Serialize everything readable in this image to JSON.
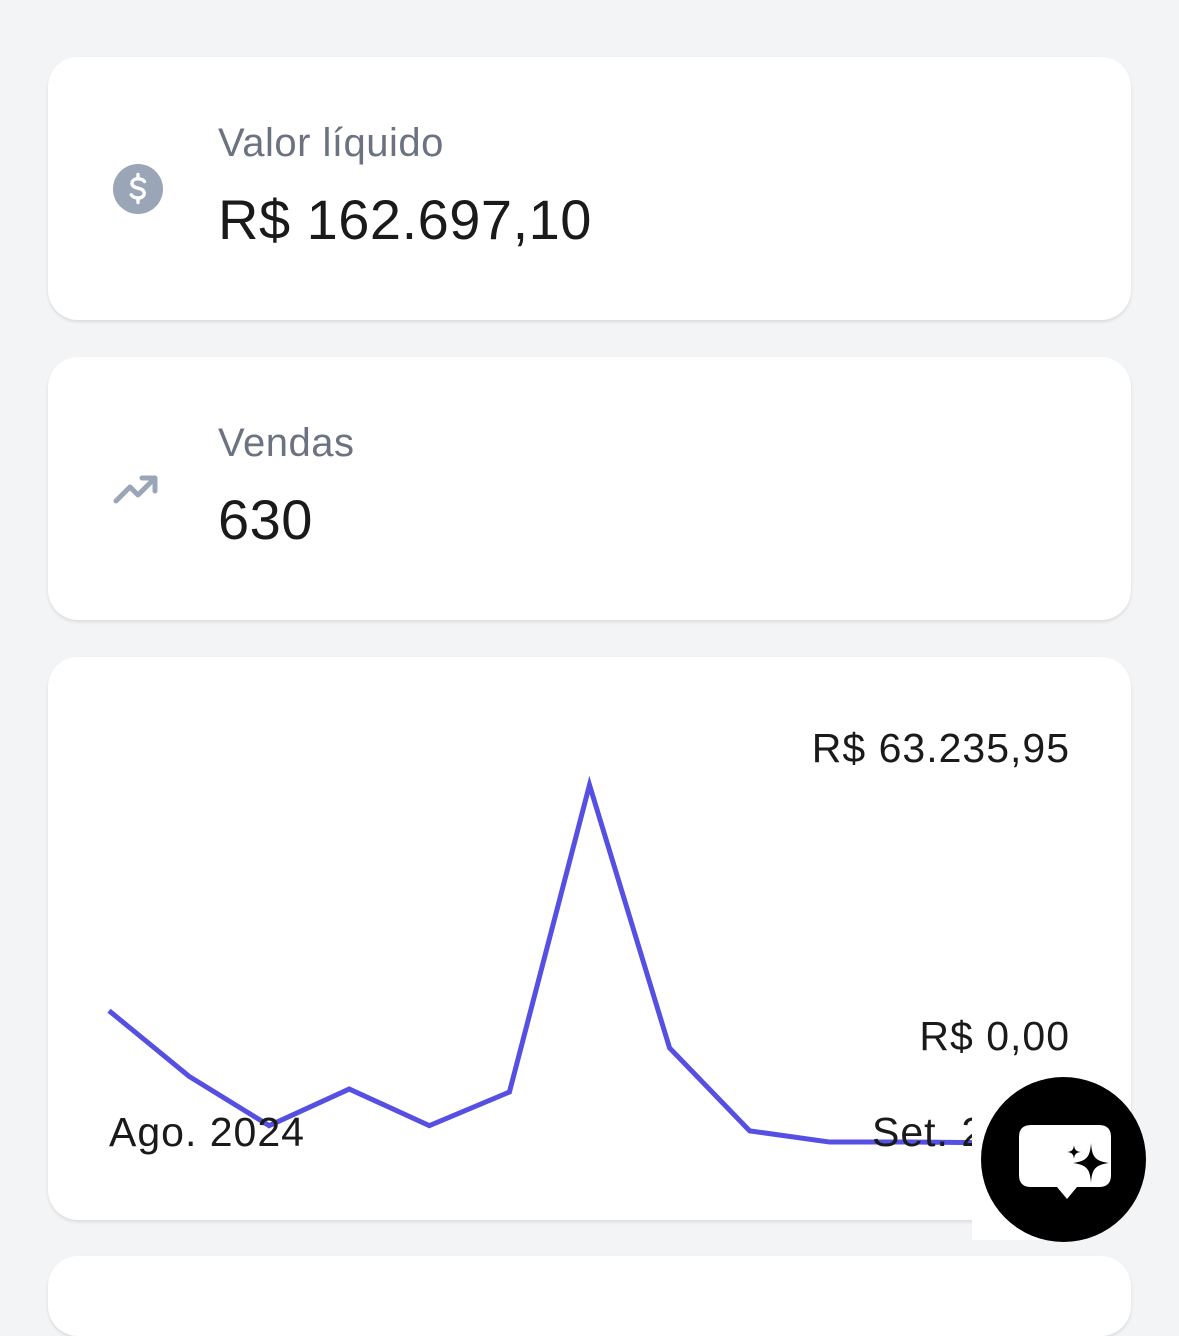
{
  "cards": {
    "net_value": {
      "label": "Valor líquido",
      "value": "R$ 162.697,10",
      "icon": "dollar-circle-icon"
    },
    "sales": {
      "label": "Vendas",
      "value": "630",
      "icon": "trending-up-icon"
    }
  },
  "chart": {
    "max_label": "R$ 63.235,95",
    "min_label": "R$ 0,00",
    "start_label": "Ago. 2024",
    "end_label": "Set. 2"
  },
  "chart_data": {
    "type": "line",
    "x_start": "Ago. 2024",
    "x_end": "Set. 2…",
    "ylim": [
      0,
      63235.95
    ],
    "series": [
      {
        "color": "#5650e2",
        "values": [
          33000,
          24200,
          17600,
          22500,
          17600,
          22100,
          63235.95,
          28000,
          16900,
          15400,
          15400,
          15300,
          15300
        ]
      }
    ]
  },
  "fab": {
    "icon": "ai-chat-sparkle-icon"
  },
  "colors": {
    "accent": "#5650e2",
    "icon_gray": "#9aa5b8",
    "label_gray": "#6b7280",
    "background": "#f3f4f6"
  }
}
